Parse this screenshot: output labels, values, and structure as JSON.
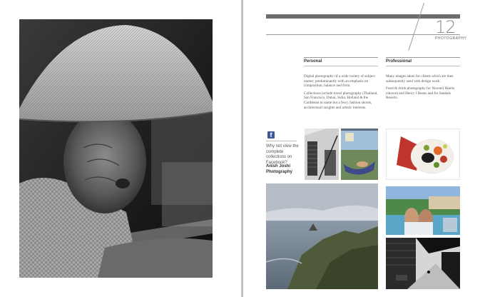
{
  "header": {
    "page_number": "12",
    "section": "PHOTOGRAPHY"
  },
  "columns": [
    {
      "title": "Personal",
      "paragraphs": [
        "Digital photography of a wide variety of subject matter; predominantly with an emphasis on composition, balance and form.",
        "Collections include travel photography (Thailand, San Francisco, Dubai, India, Holland & the Caribbean to name but a few), fashion shoots, architectural insights and artistic interests."
      ]
    },
    {
      "title": "Professional",
      "paragraphs": [
        "Many images taken for  clients which are then subsequently used with design work.",
        "Food & drink photography for Nowteil Hotels (shown) and Henry J Beans and for Sandals Resorts."
      ]
    }
  ],
  "facebook": {
    "icon": "facebook-icon",
    "text": "Why not view the complete collections on Facebook?",
    "author": "Anish Joshi Photography"
  },
  "colors": {
    "header_bar": "#6d6d6d",
    "facebook_blue": "#3b5998"
  }
}
